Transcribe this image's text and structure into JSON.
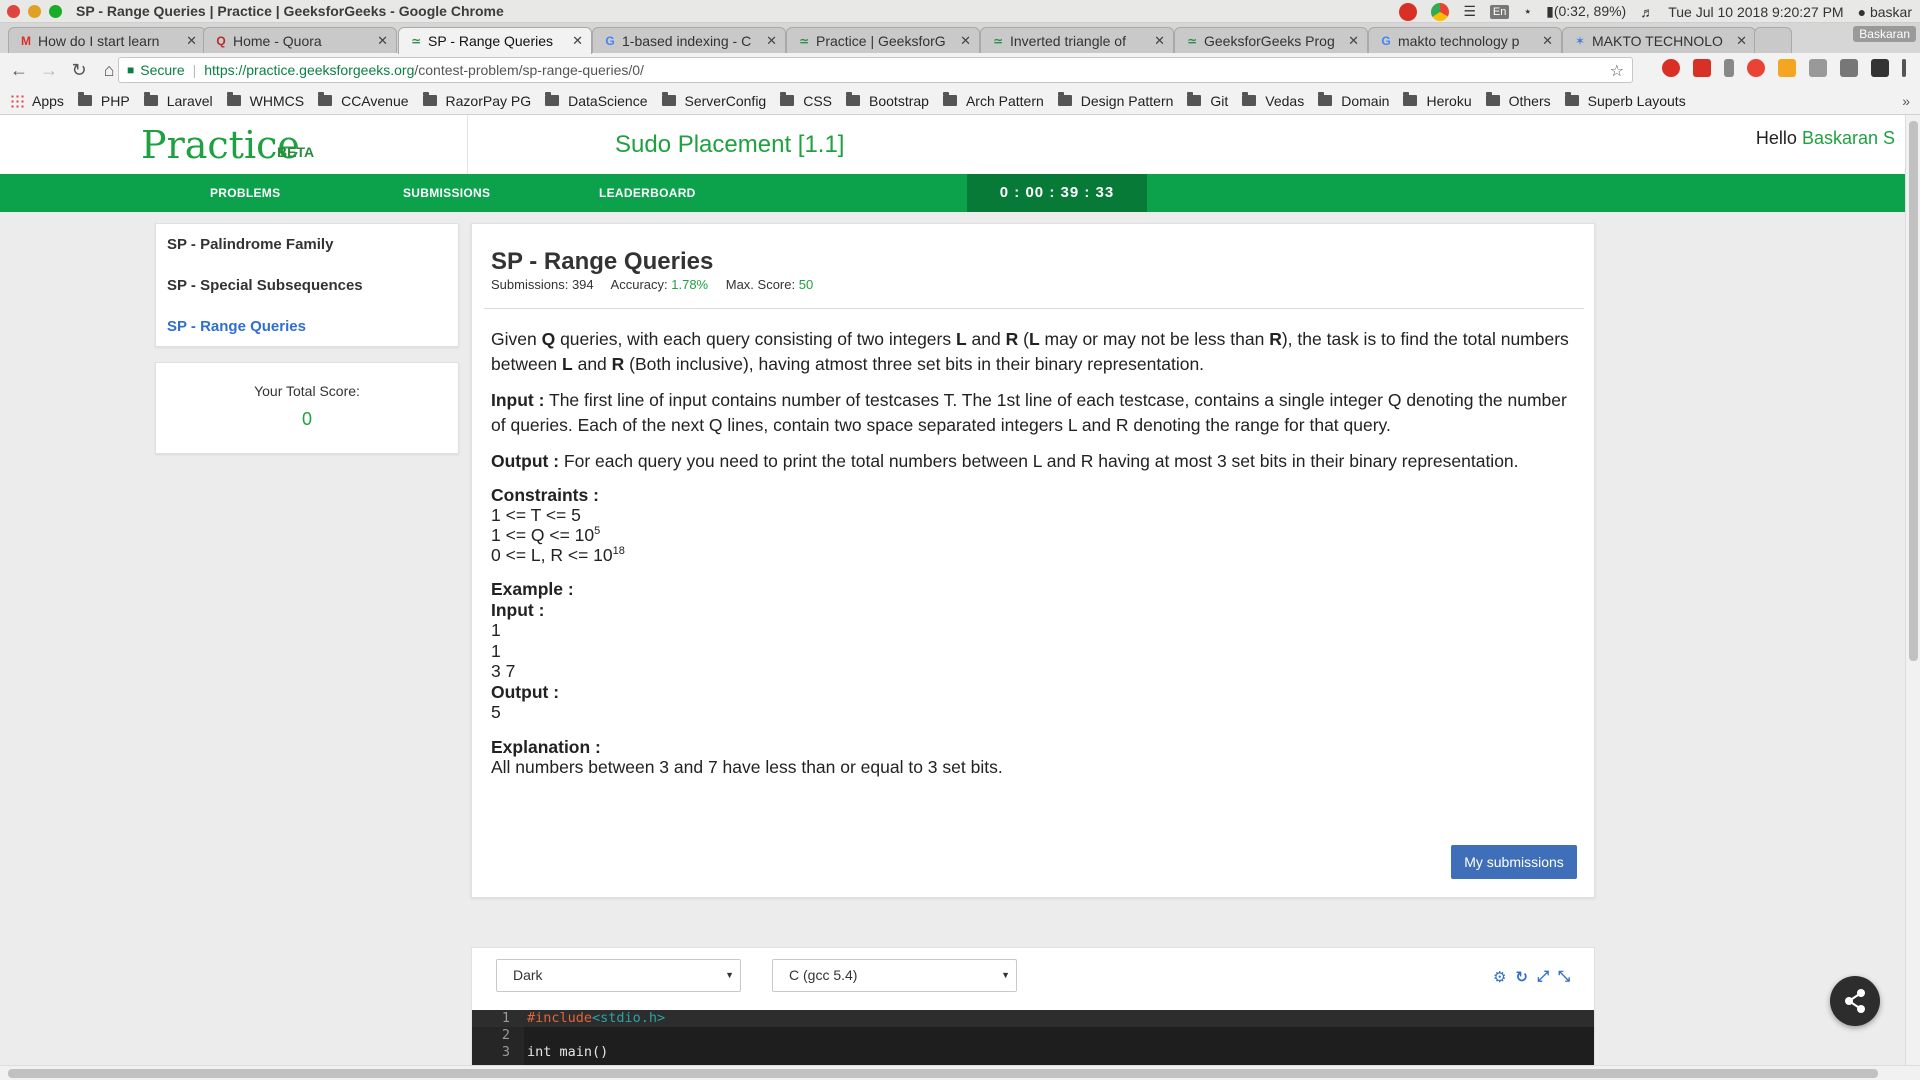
{
  "window": {
    "title": "SP - Range Queries | Practice | GeeksforGeeks - Google Chrome",
    "battery": "(0:32, 89%)",
    "datetime": "Tue Jul 10 2018  9:20:27 PM",
    "user": "baskar",
    "lang": "En",
    "profile": "Baskaran"
  },
  "tabs": [
    {
      "label": "How do I start learn",
      "icon": "gmail-icon"
    },
    {
      "label": "Home - Quora",
      "icon": "quora-icon"
    },
    {
      "label": "SP - Range Queries",
      "icon": "gfg-icon",
      "active": true
    },
    {
      "label": "1-based indexing - C",
      "icon": "google-icon"
    },
    {
      "label": "Practice | GeeksforG",
      "icon": "gfg-icon"
    },
    {
      "label": "Inverted triangle of",
      "icon": "gfg-icon"
    },
    {
      "label": "GeeksforGeeks Prog",
      "icon": "gfg-icon"
    },
    {
      "label": "makto technology p",
      "icon": "google-icon"
    },
    {
      "label": "MAKTO TECHNOLO",
      "icon": "makto-icon"
    }
  ],
  "address": {
    "secure_label": "Secure",
    "url_scheme_host": "https://practice.geeksforgeeks.org",
    "url_path": "/contest-problem/sp-range-queries/0/"
  },
  "bookmarks": {
    "apps_label": "Apps",
    "folders": [
      "PHP",
      "Laravel",
      "WHMCS",
      "CCAvenue",
      "RazorPay PG",
      "DataScience",
      "ServerConfig",
      "CSS",
      "Bootstrap",
      "Arch Pattern",
      "Design Pattern",
      "Git",
      "Vedas",
      "Domain",
      "Heroku",
      "Others",
      "Superb Layouts"
    ],
    "more": "»"
  },
  "header": {
    "logo": "Practice",
    "beta": "BETA",
    "contest": "Sudo Placement [1.1]",
    "hello": "Hello",
    "username": "Baskaran S"
  },
  "nav": {
    "problems": "PROBLEMS",
    "submissions": "SUBMISSIONS",
    "leaderboard": "LEADERBOARD",
    "timer": "0 : 00 : 39 : 33"
  },
  "sidebar": {
    "problems": [
      {
        "label": "SP - Palindrome Family",
        "active": false
      },
      {
        "label": "SP - Special Subsequences",
        "active": false
      },
      {
        "label": "SP - Range Queries",
        "active": true
      }
    ],
    "score_label": "Your Total Score:",
    "score_value": "0"
  },
  "problem": {
    "title": "SP - Range Queries",
    "submissions_label": "Submissions:",
    "submissions_value": "394",
    "accuracy_label": "Accuracy:",
    "accuracy_value": "1.78%",
    "max_score_label": "Max. Score:",
    "max_score_value": "50",
    "statement": {
      "t1": "Given ",
      "q": "Q",
      "t2": " queries, with each query consisting of two integers ",
      "l": "L",
      "t3": " and ",
      "r": "R",
      "t4": " (",
      "l2": "L",
      "t5": " may or may not be less than ",
      "r2": "R",
      "t6": "), the task is to find the total numbers between ",
      "l3": "L",
      "t7": " and ",
      "r3": "R",
      "t8": " (Both inclusive), having atmost three set bits in their binary representation."
    },
    "input_label": "Input :",
    "input_text": " The first line of input contains number of testcases T. The 1st line of each testcase, contains a single integer Q denoting the number of queries. Each of the next Q lines, contain two space separated integers L and R denoting the range for that query.",
    "output_label": "Output :",
    "output_text": " For each query you need to print the total numbers between L and R having at most 3 set bits in their binary representation.",
    "constraints_label": "Constraints :",
    "c1": "1 <= T <= 5",
    "c2_base": "1 <= Q <= 10",
    "c2_exp": "5",
    "c3_base": "0 <= L, R <= 10",
    "c3_exp": "18",
    "example_label": "Example :",
    "ex_input_label": "Input :",
    "ex_input": [
      "1",
      "1",
      "3 7"
    ],
    "ex_output_label": "Output :",
    "ex_output": "5",
    "explanation_label": "Explanation :",
    "explanation": "All numbers between 3 and 7 have less than or equal to 3 set bits.",
    "my_submissions": "My submissions"
  },
  "editor": {
    "theme": "Dark",
    "language": "C (gcc 5.4)",
    "lines": [
      {
        "n": "1",
        "kw": "#include",
        "inc": "<stdio.h>",
        "rest": ""
      },
      {
        "n": "2",
        "kw": "",
        "inc": "",
        "rest": ""
      },
      {
        "n": "3",
        "kw": "",
        "inc": "",
        "rest": "int main()"
      }
    ]
  },
  "colors": {
    "brand_green": "#0ba24b",
    "timer_bg": "#067a36",
    "link_blue": "#2f6fd0",
    "button_blue": "#3e6fb8"
  }
}
